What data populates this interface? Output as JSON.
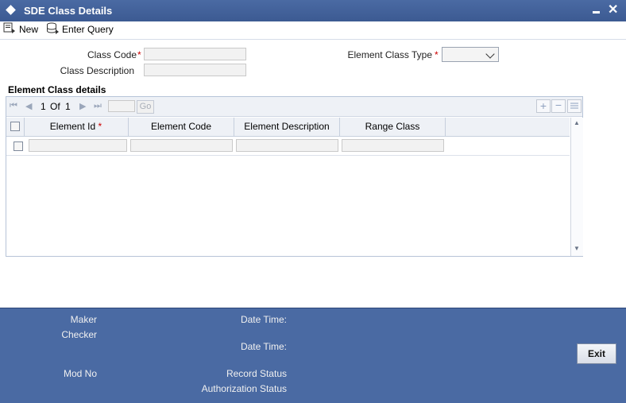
{
  "window": {
    "title": "SDE Class Details"
  },
  "toolbar": {
    "new_label": "New",
    "enter_query_label": "Enter Query"
  },
  "form": {
    "class_code_label": "Class Code",
    "class_description_label": "Class Description",
    "element_class_type_label": "Element Class Type",
    "required_mark": "*",
    "class_code_value": "",
    "class_description_value": "",
    "element_class_type_value": ""
  },
  "grid": {
    "section_title": "Element Class details",
    "pager": {
      "current": "1",
      "of_label": "Of",
      "total": "1",
      "go_label": "Go",
      "page_input": ""
    },
    "columns": [
      "Element Id",
      "Element Code",
      "Element Description",
      "Range Class"
    ],
    "required_mark": "*",
    "rows": [
      {
        "element_id": "",
        "element_code": "",
        "element_description": "",
        "range_class": ""
      }
    ]
  },
  "footer": {
    "maker_label": "Maker",
    "checker_label": "Checker",
    "date_time_label": "Date Time:",
    "mod_no_label": "Mod No",
    "record_status_label": "Record Status",
    "authorization_status_label": "Authorization Status",
    "exit_label": "Exit"
  },
  "colors": {
    "title_bar": "#3f5f98",
    "footer": "#4a6aa3",
    "required": "#cc0000"
  }
}
